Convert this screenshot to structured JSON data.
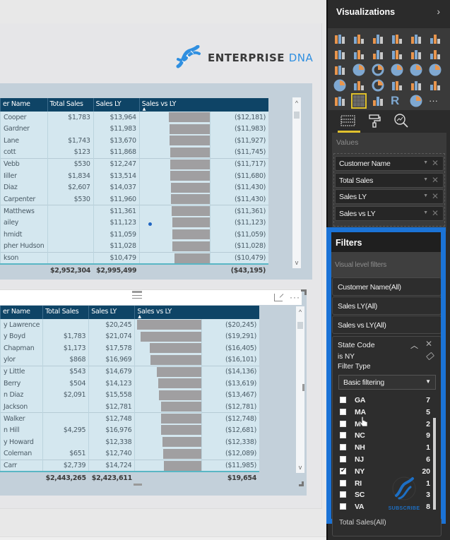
{
  "brand": {
    "name_main": "ENTERPRISE",
    "name_accent": "DNA",
    "accent_color": "#2f8fe0"
  },
  "colors": {
    "table_header": "#0e4466",
    "table_row": "#d4e7ef",
    "bar": "#a09fa1",
    "highlight": "#1b73d6",
    "total_line": "#59b6c4"
  },
  "table_top": {
    "columns": [
      "er Name",
      "Total Sales",
      "Sales LY",
      "Sales vs LY"
    ],
    "sorted_column": "Sales vs LY",
    "rows": [
      {
        "name": "Cooper",
        "total_sales": "$1,783",
        "sales_ly": "$13,964",
        "vs_ly": "($12,181)",
        "value": -12181
      },
      {
        "name": "Gardner",
        "total_sales": "",
        "sales_ly": "$11,983",
        "vs_ly": "($11,983)",
        "value": -11983
      },
      {
        "name": " Lane",
        "total_sales": "$1,743",
        "sales_ly": "$13,670",
        "vs_ly": "($11,927)",
        "value": -11927
      },
      {
        "name": "cott",
        "total_sales": "$123",
        "sales_ly": "$11,868",
        "vs_ly": "($11,745)",
        "value": -11745
      },
      {
        "name": "Vebb",
        "total_sales": "$530",
        "sales_ly": "$12,247",
        "vs_ly": "($11,717)",
        "value": -11717
      },
      {
        "name": "Iiller",
        "total_sales": "$1,834",
        "sales_ly": "$13,514",
        "vs_ly": "($11,680)",
        "value": -11680
      },
      {
        "name": "Diaz",
        "total_sales": "$2,607",
        "sales_ly": "$14,037",
        "vs_ly": "($11,430)",
        "value": -11430
      },
      {
        "name": " Carpenter",
        "total_sales": "$530",
        "sales_ly": "$11,960",
        "vs_ly": "($11,430)",
        "value": -11430
      },
      {
        "name": "Matthews",
        "total_sales": "",
        "sales_ly": "$11,361",
        "vs_ly": "($11,361)",
        "value": -11361
      },
      {
        "name": "ailey",
        "total_sales": "",
        "sales_ly": "$11,123",
        "vs_ly": "($11,123)",
        "value": -11123
      },
      {
        "name": "hmidt",
        "total_sales": "",
        "sales_ly": "$11,059",
        "vs_ly": "($11,059)",
        "value": -11059
      },
      {
        "name": "pher Hudson",
        "total_sales": "",
        "sales_ly": "$11,028",
        "vs_ly": "($11,028)",
        "value": -11028
      },
      {
        "name": "kson",
        "total_sales": "",
        "sales_ly": "$10,479",
        "vs_ly": "($10,479)",
        "value": -10479
      }
    ],
    "totals": {
      "total_sales": "$2,952,304",
      "sales_ly": "$2,995,499",
      "vs_ly": "($43,195)"
    }
  },
  "table_bottom": {
    "columns": [
      "er Name",
      "Total Sales",
      "Sales LY",
      "Sales vs LY"
    ],
    "sorted_column": "Sales vs LY",
    "rows": [
      {
        "name": "y Lawrence",
        "total_sales": "",
        "sales_ly": "$20,245",
        "vs_ly": "($20,245)",
        "value": -20245
      },
      {
        "name": "y Boyd",
        "total_sales": "$1,783",
        "sales_ly": "$21,074",
        "vs_ly": "($19,291)",
        "value": -19291
      },
      {
        "name": "Chapman",
        "total_sales": "$1,173",
        "sales_ly": "$17,578",
        "vs_ly": "($16,405)",
        "value": -16405
      },
      {
        "name": "ylor",
        "total_sales": "$868",
        "sales_ly": "$16,969",
        "vs_ly": "($16,101)",
        "value": -16101
      },
      {
        "name": "y Little",
        "total_sales": "$543",
        "sales_ly": "$14,679",
        "vs_ly": "($14,136)",
        "value": -14136
      },
      {
        "name": "Berry",
        "total_sales": "$504",
        "sales_ly": "$14,123",
        "vs_ly": "($13,619)",
        "value": -13619
      },
      {
        "name": "n Diaz",
        "total_sales": "$2,091",
        "sales_ly": "$15,558",
        "vs_ly": "($13,467)",
        "value": -13467
      },
      {
        "name": "Jackson",
        "total_sales": "",
        "sales_ly": "$12,781",
        "vs_ly": "($12,781)",
        "value": -12781
      },
      {
        "name": "Walker",
        "total_sales": "",
        "sales_ly": "$12,748",
        "vs_ly": "($12,748)",
        "value": -12748
      },
      {
        "name": "n Hill",
        "total_sales": "$4,295",
        "sales_ly": "$16,976",
        "vs_ly": "($12,681)",
        "value": -12681
      },
      {
        "name": "y Howard",
        "total_sales": "",
        "sales_ly": "$12,338",
        "vs_ly": "($12,338)",
        "value": -12338
      },
      {
        "name": "Coleman",
        "total_sales": "$651",
        "sales_ly": "$12,740",
        "vs_ly": "($12,089)",
        "value": -12089
      },
      {
        "name": "Carr",
        "total_sales": "$2,739",
        "sales_ly": "$14,724",
        "vs_ly": "($11,985)",
        "value": -11985
      }
    ],
    "totals": {
      "total_sales": "$2,443,265",
      "sales_ly": "$2,423,611",
      "vs_ly": "$19,654"
    }
  },
  "visual_header": {
    "more_label": "···"
  },
  "pane": {
    "title": "Visualizations",
    "expand_glyph": "›",
    "viz_icons": [
      "stacked-bar-icon",
      "stacked-column-icon",
      "clustered-bar-icon",
      "clustered-column-icon",
      "100-stacked-bar-icon",
      "100-stacked-column-icon",
      "line-chart-icon",
      "area-chart-icon",
      "stacked-area-icon",
      "line-column-icon",
      "line-clustered-column-icon",
      "ribbon-chart-icon",
      "scatter-chart-icon",
      "pie-chart-icon",
      "donut-chart-icon",
      "treemap-icon",
      "map-icon",
      "filled-map-icon",
      "shape-map-icon",
      "funnel-icon",
      "gauge-icon",
      "card-icon",
      "multi-row-card-icon",
      "kpi-icon",
      "slicer-icon",
      "table-icon",
      "matrix-icon",
      "r-visual-icon",
      "globe-map-icon",
      "more-visuals-icon"
    ],
    "selected_viz": "table-icon",
    "r_label": "R",
    "more_label": "···",
    "tabs": [
      "fields-tab",
      "format-tab",
      "analytics-tab"
    ],
    "values_label": "Values",
    "fields": [
      "Customer Name",
      "Total Sales",
      "Sales LY",
      "Sales vs LY"
    ]
  },
  "filters": {
    "title": "Filters",
    "section_label": "Visual level filters",
    "cards": [
      "Customer Name(All)",
      "Sales LY(All)",
      "Sales vs LY(All)"
    ],
    "open_filter": {
      "field": "State Code",
      "summary": "is NY",
      "filter_type_label": "Filter Type",
      "filter_type_value": "Basic filtering",
      "options": [
        {
          "code": "GA",
          "count": "7",
          "checked": false
        },
        {
          "code": "MA",
          "count": "5",
          "checked": false
        },
        {
          "code": "M",
          "count": "2",
          "checked": false
        },
        {
          "code": "NC",
          "count": "9",
          "checked": false
        },
        {
          "code": "NH",
          "count": "1",
          "checked": false
        },
        {
          "code": "NJ",
          "count": "6",
          "checked": false
        },
        {
          "code": "NY",
          "count": "20",
          "checked": true
        },
        {
          "code": "RI",
          "count": "1",
          "checked": false
        },
        {
          "code": "SC",
          "count": "3",
          "checked": false
        },
        {
          "code": "VA",
          "count": "8",
          "checked": false
        }
      ]
    },
    "below_card": "Total Sales(All)"
  },
  "subscribe": {
    "label": "SUBSCRIBE"
  }
}
